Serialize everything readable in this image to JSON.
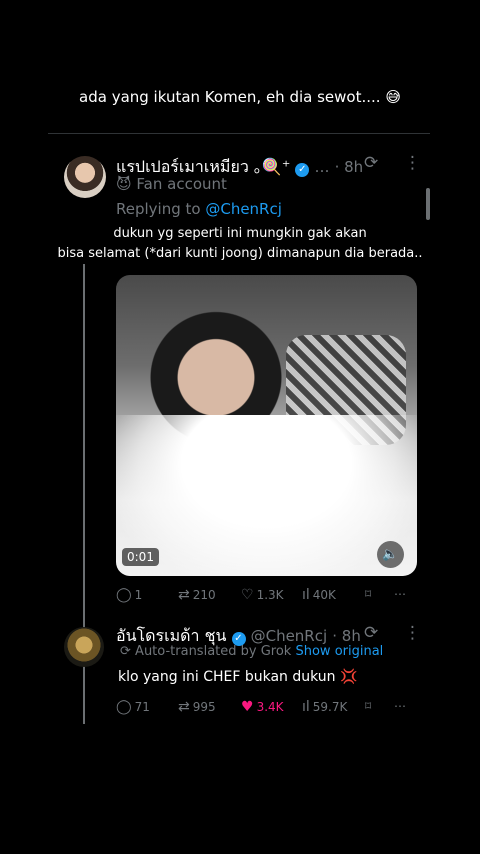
{
  "caption": "ada yang ikutan Komen, eh dia sewot....",
  "caption_emoji": "😅",
  "tweet1": {
    "name": "แรปเปอร์เมาเหมียว ｡🍭⁺",
    "verified_mark": "✓",
    "dots": "…",
    "time": "· 8h",
    "badge_icon": "😈",
    "badge": "Fan account",
    "replying_prefix": "Replying to ",
    "replying_handle": "@ChenRcj",
    "text_line1": "dukun yg seperti ini mungkin gak akan",
    "text_line2": "bisa selamat (*dari kunti joong) dimanapun dia berada..",
    "duration": "0:01",
    "mute": "🔈",
    "replies": "1",
    "retweets": "210",
    "likes": "1.3K",
    "views": "40K"
  },
  "tweet2": {
    "name": "อันโดรเมด้า ชุน",
    "verified_mark": "✓",
    "handle": "@ChenRcj",
    "time": "· 8h",
    "translated_label": "Auto-translated by Grok",
    "show_original": "Show original",
    "text": "klo yang ini CHEF bukan dukun",
    "text_emoji": "💢",
    "replies": "71",
    "retweets": "995",
    "likes": "3.4K",
    "views": "59.7K"
  },
  "icons": {
    "grok": "⟳",
    "more": "⋮",
    "reply": "◯",
    "retweet": "⇄",
    "like": "♡",
    "liked": "♥",
    "views": "ıl",
    "bookmark": "⌑",
    "share": "⋯"
  },
  "colors": {
    "accent": "#1d9bf0",
    "like": "#f91880",
    "muted": "#71767b"
  }
}
